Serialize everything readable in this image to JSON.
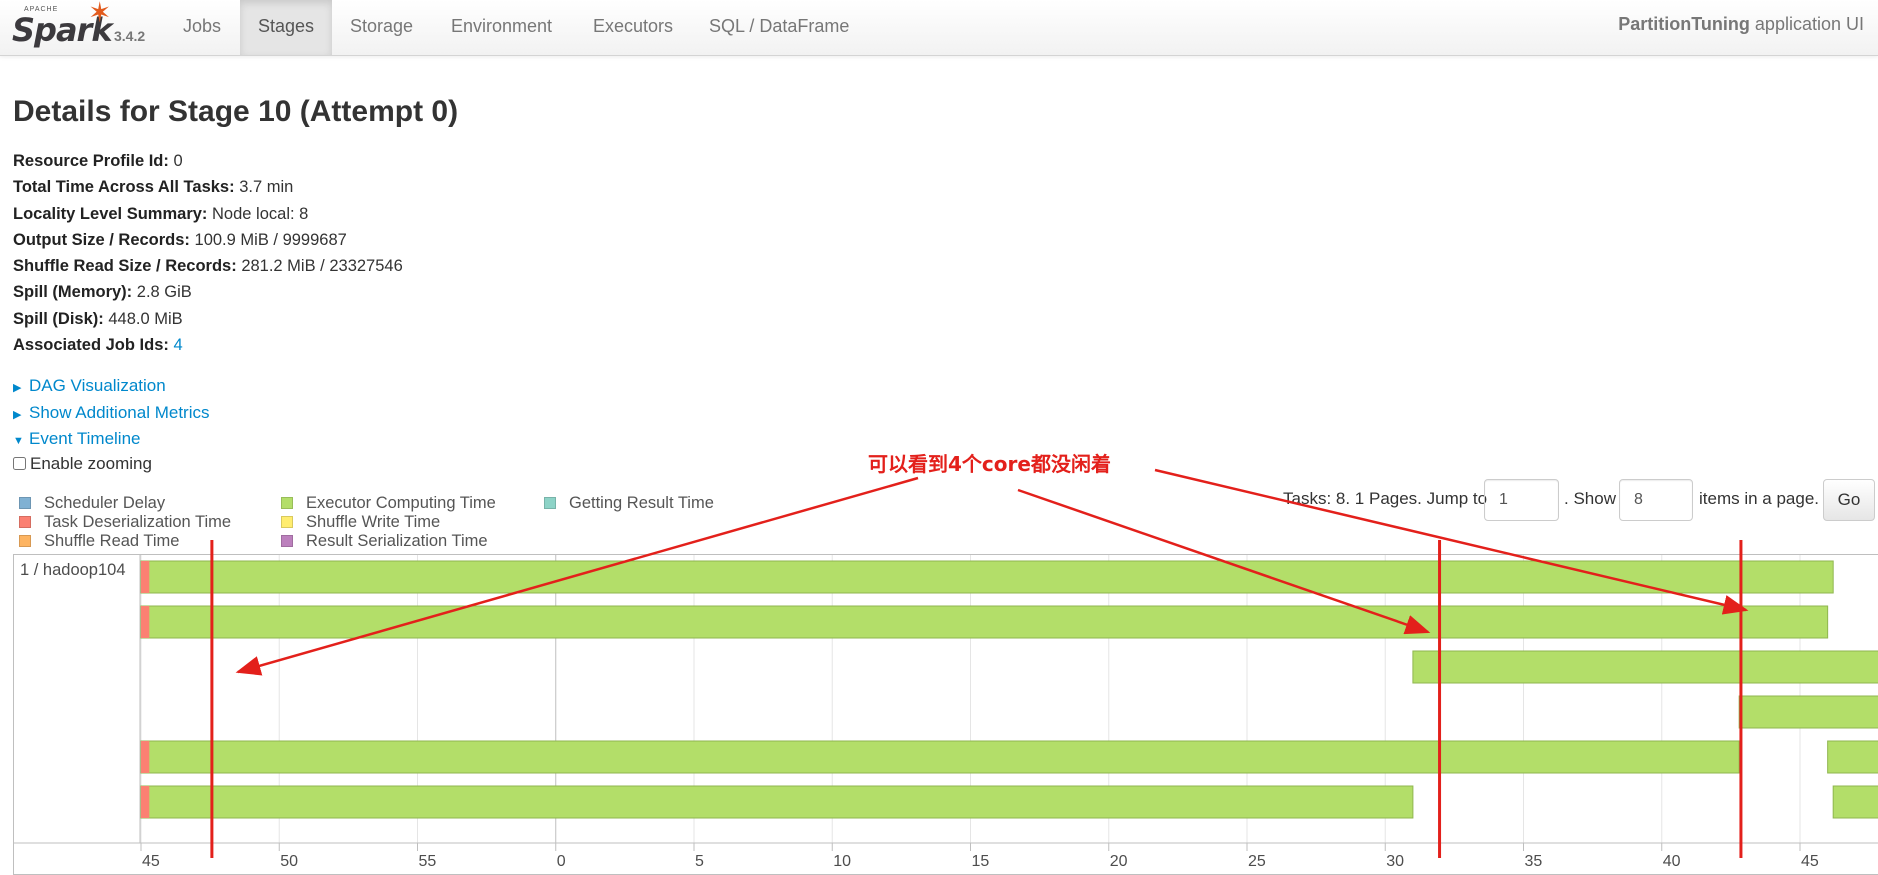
{
  "nav": {
    "brand_small": "APACHE",
    "brand_name": "Spark",
    "version": "3.4.2",
    "tabs": [
      {
        "label": "Jobs"
      },
      {
        "label": "Stages"
      },
      {
        "label": "Storage"
      },
      {
        "label": "Environment"
      },
      {
        "label": "Executors"
      },
      {
        "label": "SQL / DataFrame"
      }
    ],
    "active_tab": "Stages",
    "app_name": "PartitionTuning",
    "app_suffix": " application UI"
  },
  "page": {
    "title": "Details for Stage 10 (Attempt 0)"
  },
  "summary": [
    {
      "label": "Resource Profile Id:",
      "value": "0"
    },
    {
      "label": "Total Time Across All Tasks:",
      "value": "3.7 min"
    },
    {
      "label": "Locality Level Summary:",
      "value": "Node local: 8"
    },
    {
      "label": "Output Size / Records:",
      "value": "100.9 MiB / 9999687"
    },
    {
      "label": "Shuffle Read Size / Records:",
      "value": "281.2 MiB / 23327546"
    },
    {
      "label": "Spill (Memory):",
      "value": "2.8 GiB"
    },
    {
      "label": "Spill (Disk):",
      "value": "448.0 MiB"
    },
    {
      "label": "Associated Job Ids:",
      "value": "4"
    }
  ],
  "toggles": {
    "dag": "DAG Visualization",
    "metrics": "Show Additional Metrics",
    "timeline": "Event Timeline",
    "zoom": "Enable zooming"
  },
  "legend": [
    {
      "label": "Scheduler Delay",
      "color": "#80B1D3"
    },
    {
      "label": "Task Deserialization Time",
      "color": "#FB8072"
    },
    {
      "label": "Shuffle Read Time",
      "color": "#FDB462"
    },
    {
      "label": "Executor Computing Time",
      "color": "#B3DE69"
    },
    {
      "label": "Shuffle Write Time",
      "color": "#FFED6F"
    },
    {
      "label": "Result Serialization Time",
      "color": "#BC80BD"
    },
    {
      "label": "Getting Result Time",
      "color": "#8DD3C7"
    }
  ],
  "pagination": {
    "tasks_text": "Tasks: 8. 1 Pages. Jump to",
    "page_value": "1",
    "show_text": ". Show",
    "page_size": "8",
    "items_text": "items in a page.",
    "go_label": "Go"
  },
  "timeline": {
    "host_label": "1 / hadoop104",
    "axis_ticks": [
      "45",
      "50",
      "55",
      "0",
      "5",
      "10",
      "15",
      "20",
      "25",
      "30",
      "35",
      "40",
      "45"
    ],
    "tasks": [
      {
        "row": 0,
        "start": 45.0,
        "end": 106.2,
        "deser_end": 45.3
      },
      {
        "row": 1,
        "start": 45.0,
        "end": 106.0,
        "deser_end": 45.3
      },
      {
        "row": 2,
        "start": 91.0,
        "end": 108.0,
        "deser_end": 91.0
      },
      {
        "row": 3,
        "start": 102.8,
        "end": 108.0,
        "deser_end": 102.8
      },
      {
        "row": 4,
        "start": 45.0,
        "end": 102.8,
        "deser_end": 45.3
      },
      {
        "row": 4,
        "start": 106.0,
        "end": 108.0,
        "deser_end": 106.0
      },
      {
        "row": 5,
        "start": 45.0,
        "end": 91.0,
        "deser_end": 45.3
      },
      {
        "row": 5,
        "start": 106.2,
        "end": 108.0,
        "deser_end": 106.2
      }
    ],
    "markers": [
      47.6,
      92.0,
      102.9
    ]
  },
  "annotation": {
    "text": "可以看到4个core都没闲着",
    "color": "#e3201b"
  }
}
